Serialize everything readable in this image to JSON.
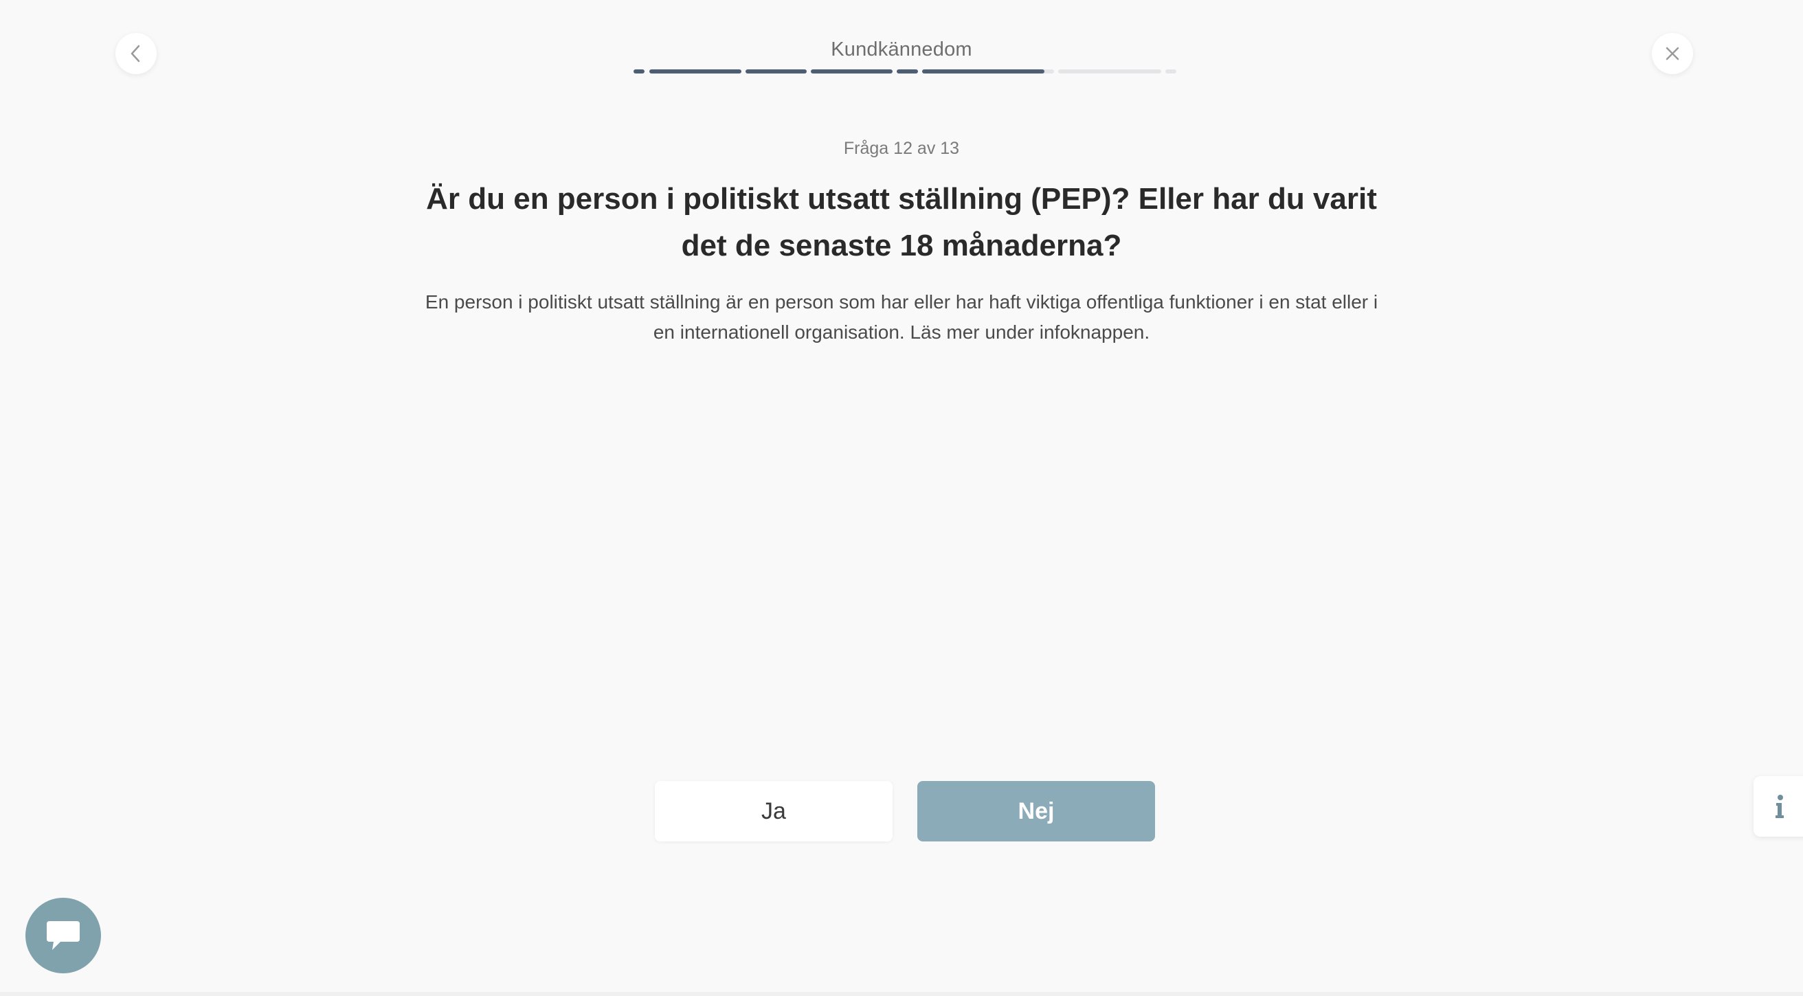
{
  "header": {
    "step_title": "Kundkännedom",
    "progress": {
      "segments_completed": 6,
      "segments_total": 8
    },
    "back_icon": "chevron-left-icon",
    "close_icon": "close-icon"
  },
  "question": {
    "counter": "Fråga 12 av 13",
    "title": "Är du en person i politiskt utsatt ställning (PEP)? Eller har du varit det de senaste 18 månaderna?",
    "description": "En person i politiskt utsatt ställning är en person som har eller har haft viktiga offentliga funktioner i en stat eller i en internationell organisation. Läs mer under infoknappen."
  },
  "answers": {
    "yes_label": "Ja",
    "no_label": "Nej"
  },
  "widgets": {
    "info_icon": "info-icon",
    "chat_icon": "chat-bubble-icon"
  },
  "colors": {
    "progress_active": "#4e5f75",
    "progress_inactive": "#e5e5e8",
    "primary_button": "#8aabb7",
    "chat_button": "#7fa2ad"
  }
}
